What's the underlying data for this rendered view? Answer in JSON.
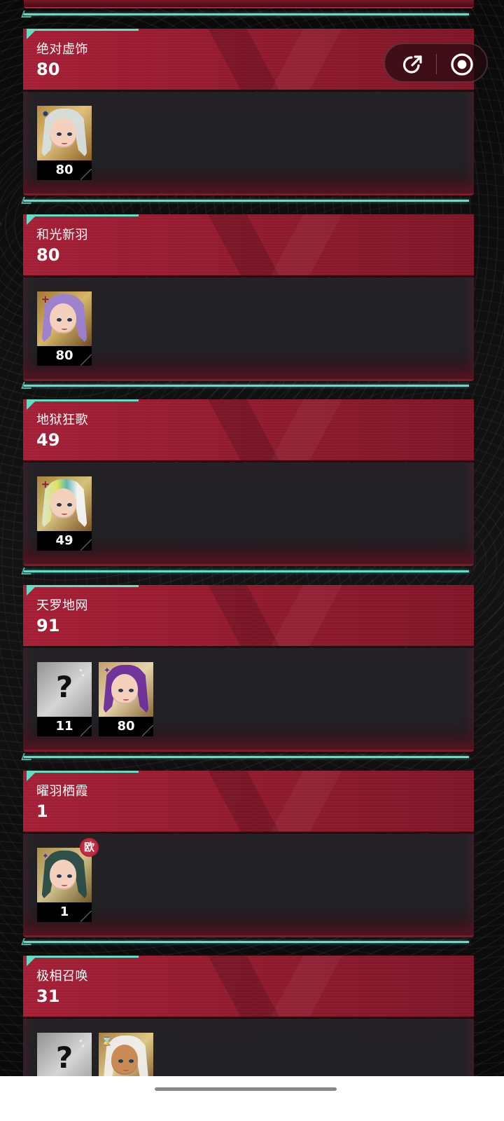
{
  "cards": [
    {
      "title": "绝对虚饰",
      "count": "80",
      "characters": [
        {
          "level": "80",
          "portrait_type": "white",
          "element_icon": "blue-compass-icon",
          "badge": ""
        }
      ]
    },
    {
      "title": "和光新羽",
      "count": "80",
      "characters": [
        {
          "level": "80",
          "portrait_type": "purple",
          "element_icon": "red-cross-icon",
          "badge": ""
        }
      ]
    },
    {
      "title": "地狱狂歌",
      "count": "49",
      "characters": [
        {
          "level": "49",
          "portrait_type": "rainbow",
          "element_icon": "red-cross-icon",
          "badge": ""
        }
      ]
    },
    {
      "title": "天罗地网",
      "count": "91",
      "characters": [
        {
          "level": "11",
          "portrait_type": "unknown",
          "element_icon": "",
          "badge": ""
        },
        {
          "level": "80",
          "portrait_type": "violet",
          "element_icon": "purple-spark-icon",
          "badge": ""
        }
      ]
    },
    {
      "title": "曜羽栖霞",
      "count": "1",
      "characters": [
        {
          "level": "1",
          "portrait_type": "teal",
          "element_icon": "purple-spark-icon",
          "badge": "欧"
        }
      ]
    },
    {
      "title": "极相召唤",
      "count": "31",
      "characters": [
        {
          "level": "",
          "portrait_type": "unknown",
          "element_icon": "",
          "badge": ""
        },
        {
          "level": "",
          "portrait_type": "white-brown",
          "element_icon": "hourglass-icon",
          "badge": ""
        }
      ]
    }
  ],
  "floating_controls": {
    "share_icon": "external-share-icon",
    "record_icon": "record-icon"
  },
  "colors": {
    "accent_teal": "#63ddc4",
    "header_red": "#a51f36",
    "panel_dark": "#242227",
    "badge_red": "#c32b42"
  }
}
